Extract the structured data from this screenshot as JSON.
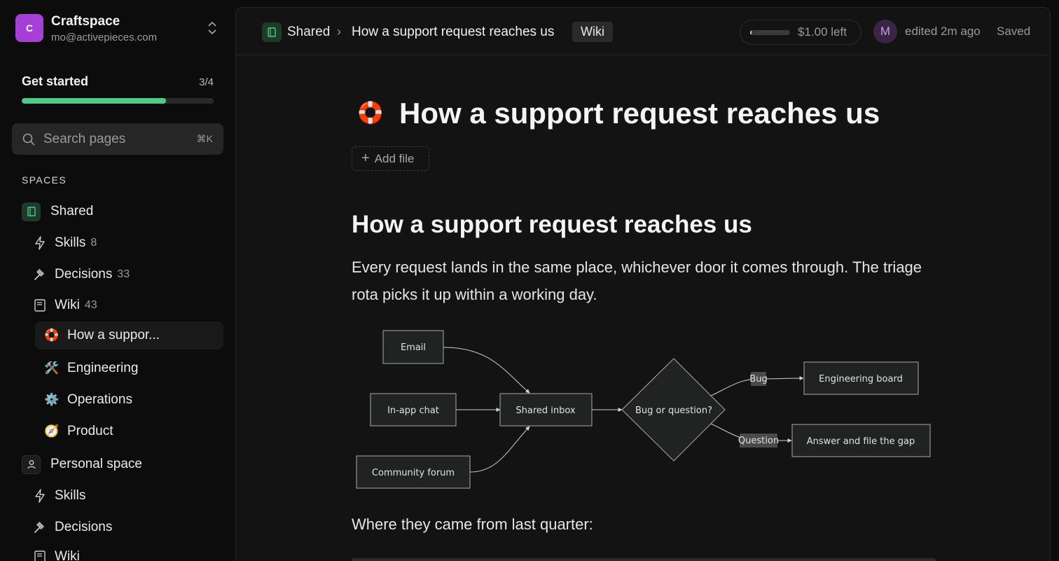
{
  "workspace": {
    "initial": "C",
    "name": "Craftspace",
    "email": "mo@activepieces.com"
  },
  "get_started": {
    "title": "Get started",
    "count": "3/4",
    "progress": 0.75
  },
  "search": {
    "label": "Search pages",
    "shortcut": "⌘K"
  },
  "spaces_title": "SPACES",
  "shared": {
    "label": "Shared",
    "items": [
      {
        "label": "Skills",
        "count": "8"
      },
      {
        "label": "Decisions",
        "count": "33"
      },
      {
        "label": "Wiki",
        "count": "43"
      }
    ],
    "wiki_pages": [
      {
        "emoji": "🛟",
        "label": "How a suppor..."
      },
      {
        "emoji": "🛠️",
        "label": "Engineering"
      },
      {
        "emoji": "⚙️",
        "label": "Operations"
      },
      {
        "emoji": "🧭",
        "label": "Product"
      }
    ]
  },
  "personal": {
    "label": "Personal space",
    "items": [
      {
        "label": "Skills"
      },
      {
        "label": "Decisions"
      },
      {
        "label": "Wiki"
      }
    ]
  },
  "topbar": {
    "space": "Shared",
    "separator": "›",
    "page": "How a support request reaches us",
    "tag": "Wiki",
    "credit": "$1.00 left",
    "credit_fraction": 0.04,
    "avatar": "M",
    "edited": "edited 2m ago",
    "status": "Saved"
  },
  "doc": {
    "emoji": "🛟",
    "title": "How a support request reaches us",
    "add_file": "Add file",
    "heading": "How a support request reaches us",
    "intro": "Every request lands in the same place, whichever door it comes through. The triage rota picks it up within a working day.",
    "after_flow": "Where they came from last quarter:"
  },
  "flowchart": {
    "nodes": {
      "email": "Email",
      "chat": "In-app chat",
      "forum": "Community forum",
      "inbox": "Shared inbox",
      "decision": "Bug or question?",
      "eng": "Engineering board",
      "answer": "Answer and file the gap"
    },
    "edges": {
      "bug": "Bug",
      "question": "Question"
    }
  },
  "colors": {
    "accent": "#4ecb87",
    "workspace": "#a63fd6",
    "background": "#0c0c0c",
    "panel": "#131313"
  }
}
